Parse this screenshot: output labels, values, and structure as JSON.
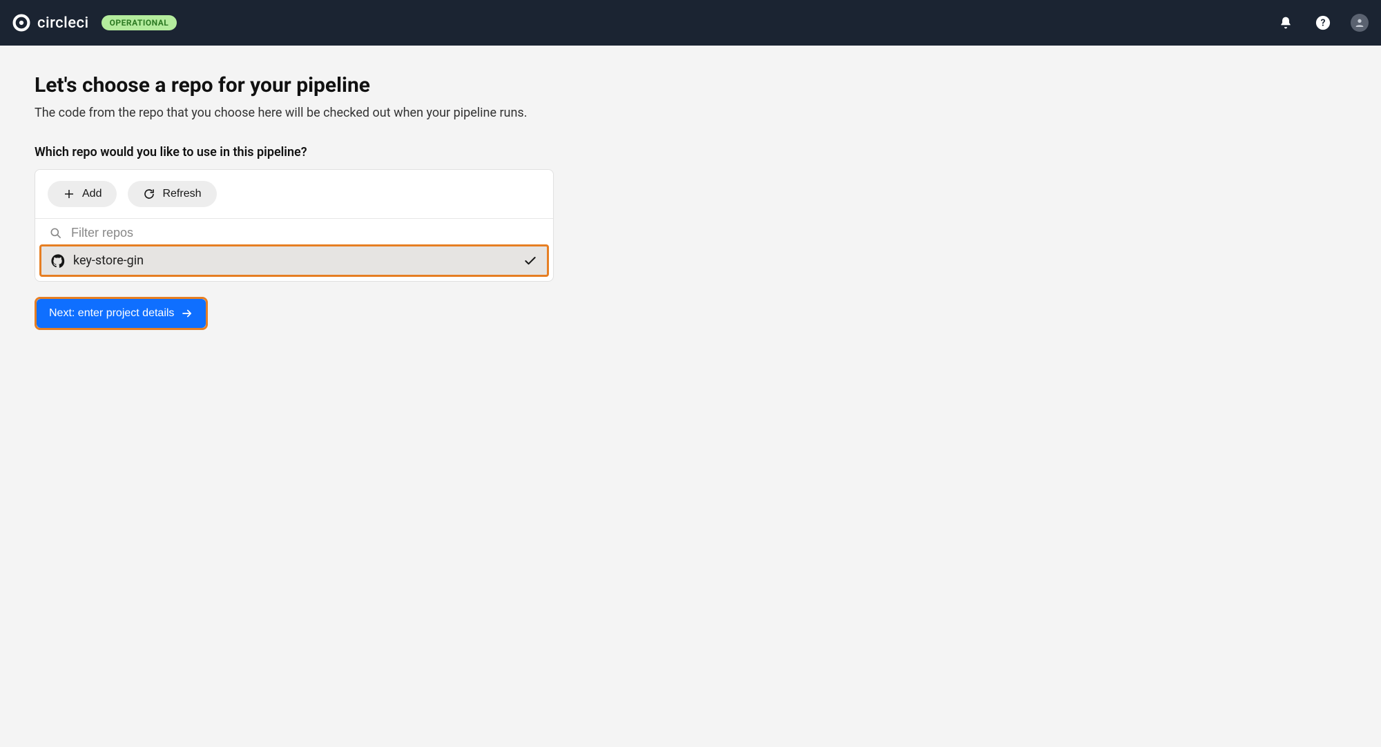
{
  "header": {
    "brand": "circleci",
    "status_badge": "OPERATIONAL"
  },
  "page": {
    "title": "Let's choose a repo for your pipeline",
    "subtitle": "The code from the repo that you choose here will be checked out when your pipeline runs.",
    "section_label": "Which repo would you like to use in this pipeline?"
  },
  "toolbar": {
    "add_label": "Add",
    "refresh_label": "Refresh"
  },
  "filter": {
    "placeholder": "Filter repos",
    "value": ""
  },
  "repos": [
    {
      "name": "key-store-gin",
      "selected": true,
      "vcs": "github"
    }
  ],
  "next_button": {
    "label": "Next: enter project details"
  }
}
